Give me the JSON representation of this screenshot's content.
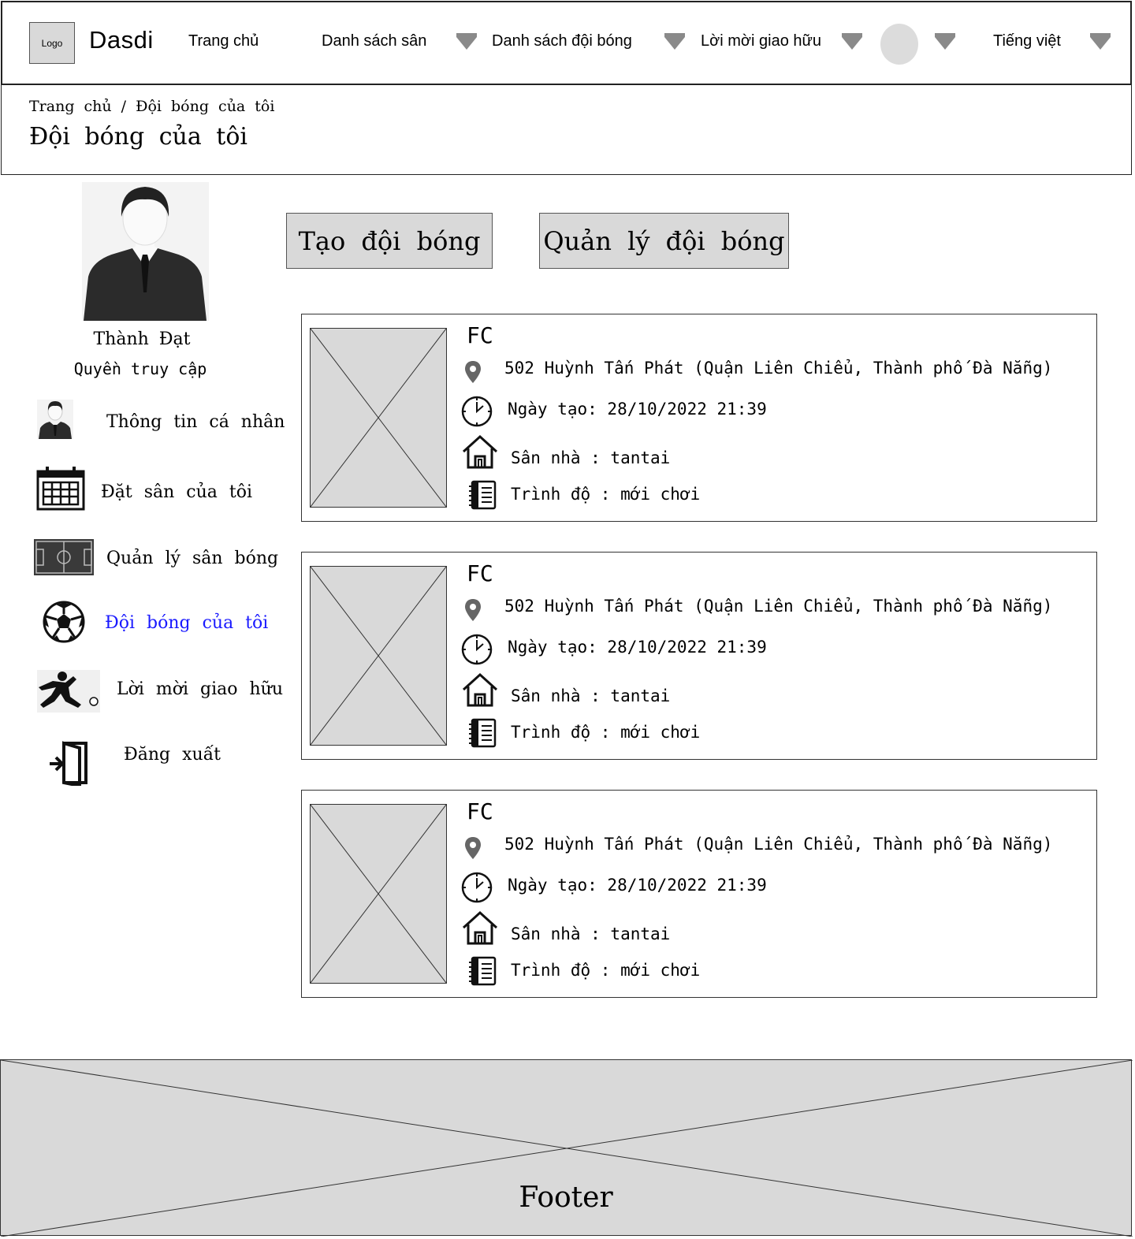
{
  "header": {
    "logo_text": "Logo",
    "brand": "Dasdi",
    "nav": {
      "home": "Trang chủ",
      "fields": "Danh sách sân",
      "teams": "Danh sách đội bóng",
      "invites": "Lời mời giao hữu",
      "language": "Tiếng việt"
    }
  },
  "breadcrumb": {
    "path": "Trang chủ / Đội bóng của tôi",
    "title": "Đội bóng của tôi"
  },
  "profile": {
    "name": "Thành Đạt",
    "role": "Quyền truy cập"
  },
  "sidebar": {
    "items": [
      {
        "label": "Thông tin cá nhân",
        "icon": "person-icon"
      },
      {
        "label": "Đặt sân của tôi",
        "icon": "calendar-icon"
      },
      {
        "label": "Quản lý sân bóng",
        "icon": "soccer-field-icon"
      },
      {
        "label": "Đội bóng của tôi",
        "icon": "soccer-ball-icon",
        "active": true
      },
      {
        "label": "Lời mời giao hữu",
        "icon": "player-kick-icon"
      },
      {
        "label": "Đăng xuất",
        "icon": "logout-icon"
      }
    ],
    "active_color": "#1a1aff"
  },
  "actions": {
    "create_team": "Tạo đội bóng",
    "manage_team": "Quản lý đội bóng"
  },
  "teams": [
    {
      "name": "FC",
      "address": "502 Huỳnh Tấn Phát (Quận Liên Chiểu, Thành phố Đà Nẵng)",
      "created": "Ngày tạo: 28/10/2022 21:39",
      "home_field": "Sân nhà : tantai",
      "level": "Trình độ : mới chơi"
    },
    {
      "name": "FC",
      "address": "502 Huỳnh Tấn Phát (Quận Liên Chiểu, Thành phố Đà Nẵng)",
      "created": "Ngày tạo: 28/10/2022 21:39",
      "home_field": "Sân nhà : tantai",
      "level": "Trình độ : mới chơi"
    },
    {
      "name": "FC",
      "address": "502 Huỳnh Tấn Phát (Quận Liên Chiểu, Thành phố Đà Nẵng)",
      "created": "Ngày tạo: 28/10/2022 21:39",
      "home_field": "Sân nhà : tantai",
      "level": "Trình độ : mới chơi"
    }
  ],
  "footer": {
    "label": "Footer"
  }
}
